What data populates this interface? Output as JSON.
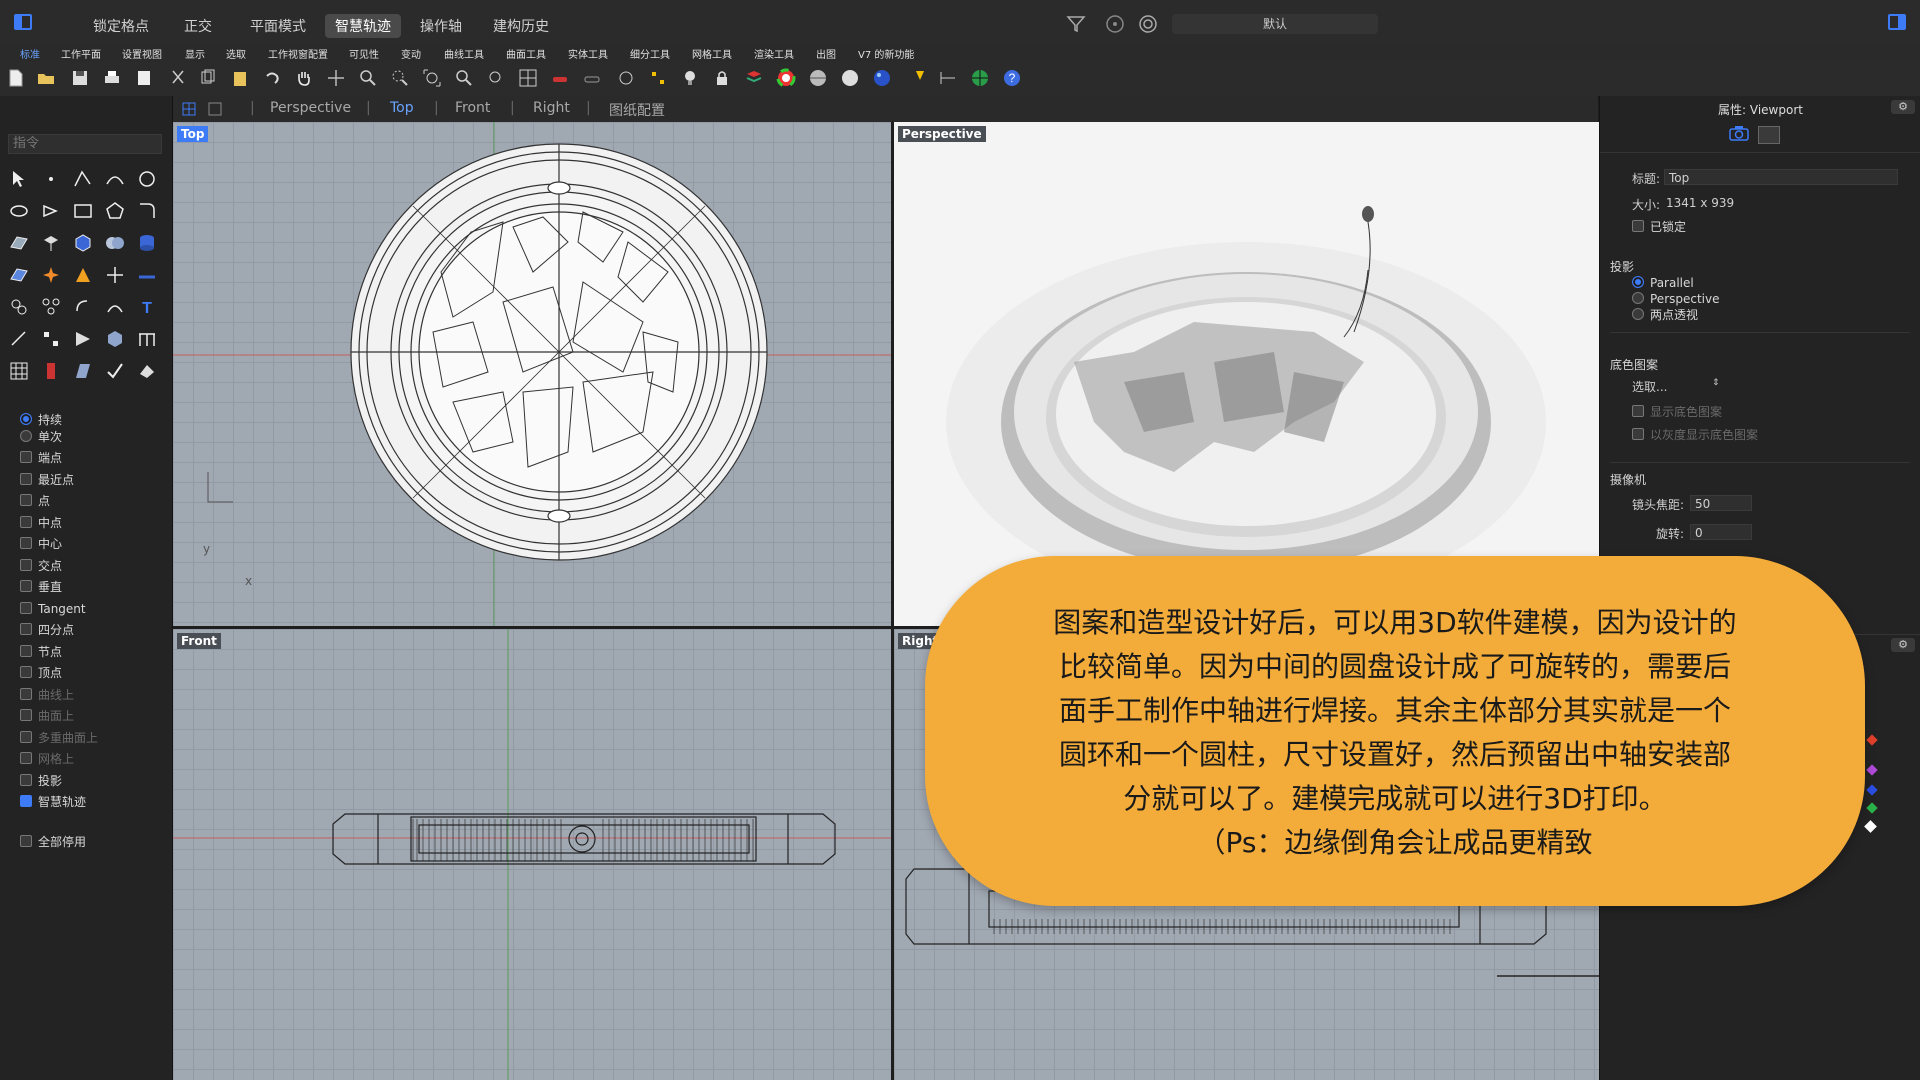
{
  "menus": [
    "锁定格点",
    "正交",
    "平面模式",
    "智慧轨迹",
    "操作轴",
    "建构历史"
  ],
  "active_menu": "智慧轨迹",
  "layer_box": "默认",
  "ribbon_tabs": [
    "标准",
    "工作平面",
    "设置视图",
    "显示",
    "选取",
    "工作视窗配置",
    "可见性",
    "变动",
    "曲线工具",
    "曲面工具",
    "实体工具",
    "细分工具",
    "网格工具",
    "渲染工具",
    "出图",
    "V7 的新功能"
  ],
  "view_tabs": [
    "Perspective",
    "Top",
    "Front",
    "Right",
    "图纸配置"
  ],
  "active_view_tab": "Top",
  "command_placeholder": "指令",
  "osnap": {
    "mode_persistent": "持续",
    "mode_single": "单次",
    "items": [
      "端点",
      "最近点",
      "点",
      "中点",
      "中心",
      "交点",
      "垂直",
      "Tangent",
      "四分点",
      "节点",
      "顶点"
    ],
    "dim_items": [
      "曲线上",
      "曲面上",
      "多重曲面上",
      "网格上"
    ],
    "projection": "投影",
    "smarttrack": "智慧轨迹",
    "disable_all": "全部停用"
  },
  "viewports": {
    "top": "Top",
    "perspective": "Perspective",
    "front": "Front",
    "right": "Right"
  },
  "axis_labels": {
    "y": "y",
    "x": "x"
  },
  "properties": {
    "header": "属性: Viewport",
    "title_label": "标题:",
    "title_value": "Top",
    "size_label": "大小:",
    "size_value": "1341 x 939",
    "locked_label": "已锁定",
    "projection_head": "投影",
    "proj_parallel": "Parallel",
    "proj_perspective": "Perspective",
    "proj_two_point": "两点透视",
    "wallpaper_head": "底色图案",
    "wallpaper_select": "选取...",
    "show_wallpaper": "显示底色图案",
    "gray_wallpaper": "以灰度显示底色图案",
    "camera_head": "摄像机",
    "focal_label": "镜头焦距:",
    "focal_value": "50",
    "rotation_label": "旋转:",
    "rotation_value": "0"
  },
  "bubble": {
    "lines": [
      "图案和造型设计好后，可以用3D软件建模，因为设计的",
      "比较简单。因为中间的圆盘设计成了可旋转的，需要后",
      "面手工制作中轴进行焊接。其余主体部分其实就是一个",
      "圆环和一个圆柱，尺寸设置好，然后预留出中轴安装部",
      "分就可以了。建模完成就可以进行3D打印。",
      "（Ps：边缘倒角会让成品更精致"
    ]
  }
}
